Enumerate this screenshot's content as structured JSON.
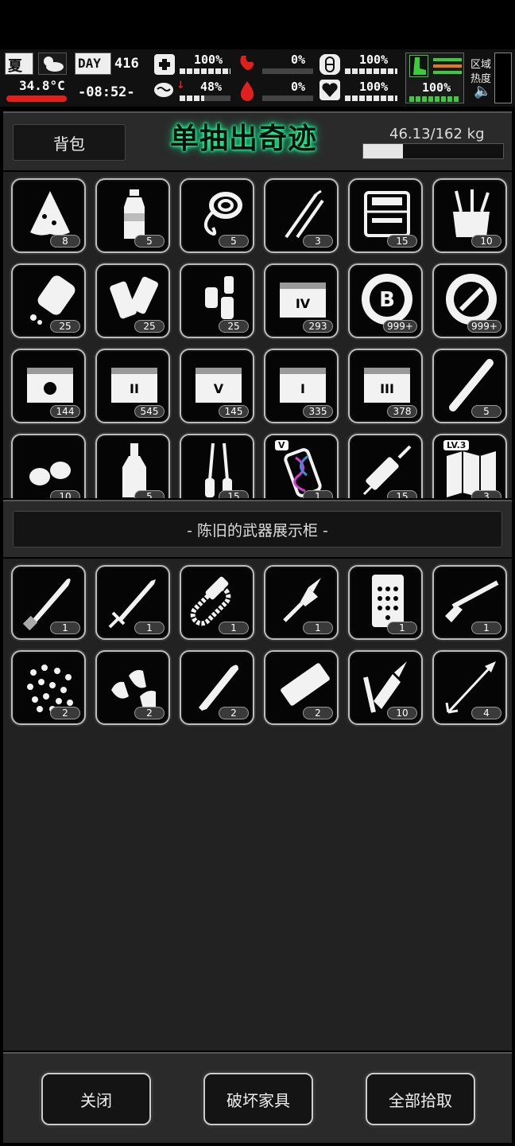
{
  "hud": {
    "season": "夏",
    "temperature": "34.8°C",
    "day_label": "DAY",
    "day": "416",
    "time": "-08:52-",
    "stats": [
      {
        "value": "100%",
        "icon": "medkit-icon",
        "fill": 1.0
      },
      {
        "value": "0%",
        "icon": "stomach-icon",
        "fill": 0.0
      },
      {
        "value": "100%",
        "icon": "pill-icon",
        "fill": 1.0
      },
      {
        "value": "48%",
        "icon": "brain-icon",
        "fill": 0.48
      },
      {
        "value": "0%",
        "icon": "blood-drop-icon",
        "fill": 0.0
      },
      {
        "value": "100%",
        "icon": "heart-icon",
        "fill": 1.0
      }
    ],
    "stamina": "100%",
    "region_label": "区域",
    "heat_label": "热度",
    "colors": {
      "accent_red": "#e0201c",
      "accent_green": "#3ccb3c",
      "accent_orange": "#e07b1a",
      "promo_glow": "#19ff9a"
    }
  },
  "backpack": {
    "tab_label": "背包",
    "promo": "单抽出奇迹",
    "weight": "46.13/162 kg",
    "weight_fill": 0.285,
    "items": [
      {
        "icon": "cloth-rag-icon",
        "count": "8"
      },
      {
        "icon": "water-bottle-icon",
        "count": "5"
      },
      {
        "icon": "rope-icon",
        "count": "5"
      },
      {
        "icon": "lockpick-icon",
        "count": "3"
      },
      {
        "icon": "toolbox-icon",
        "count": "15"
      },
      {
        "icon": "craft-kit-icon",
        "count": "10"
      },
      {
        "icon": "pill-bottle-icon",
        "count": "25"
      },
      {
        "icon": "bandage-roll-icon",
        "count": "25"
      },
      {
        "icon": "spray-cans-icon",
        "count": "25"
      },
      {
        "icon": "crate-iv-icon",
        "count": "293"
      },
      {
        "icon": "bitcoin-chip-icon",
        "count": "999+"
      },
      {
        "icon": "wrench-chip-icon",
        "count": "999+"
      },
      {
        "icon": "crate-coin-icon",
        "count": "144"
      },
      {
        "icon": "crate-ii-icon",
        "count": "545"
      },
      {
        "icon": "crate-v-icon",
        "count": "145"
      },
      {
        "icon": "crate-i-icon",
        "count": "335"
      },
      {
        "icon": "crate-iii-icon",
        "count": "378"
      },
      {
        "icon": "cigarette-icon",
        "count": "5"
      },
      {
        "icon": "seeds-icon",
        "count": "10"
      },
      {
        "icon": "liquor-bottle-icon",
        "count": "5"
      },
      {
        "icon": "pliers-icon",
        "count": "15"
      },
      {
        "icon": "dna-vial-icon",
        "count": "1",
        "tag": "V"
      },
      {
        "icon": "syringe-icon",
        "count": "15"
      },
      {
        "icon": "map-icon",
        "count": "3",
        "tag": "LV.3"
      }
    ]
  },
  "showcase": {
    "title": "- 陈旧的武器展示柜 -",
    "items": [
      {
        "icon": "machete-icon",
        "count": "1"
      },
      {
        "icon": "sword-icon",
        "count": "1"
      },
      {
        "icon": "chainsaw-icon",
        "count": "1"
      },
      {
        "icon": "spear-tip-icon",
        "count": "1"
      },
      {
        "icon": "keypad-icon",
        "count": "1"
      },
      {
        "icon": "shotgun-icon",
        "count": "1"
      },
      {
        "icon": "pellets-icon",
        "count": "2"
      },
      {
        "icon": "bullets-icon",
        "count": "2"
      },
      {
        "icon": "rifle-round-icon",
        "count": "2"
      },
      {
        "icon": "shell-icon",
        "count": "2"
      },
      {
        "icon": "bolt-icon",
        "count": "10"
      },
      {
        "icon": "arrow-icon",
        "count": "4"
      }
    ]
  },
  "footer": {
    "close_label": "关闭",
    "destroy_label": "破坏家具",
    "pickup_all_label": "全部拾取"
  }
}
